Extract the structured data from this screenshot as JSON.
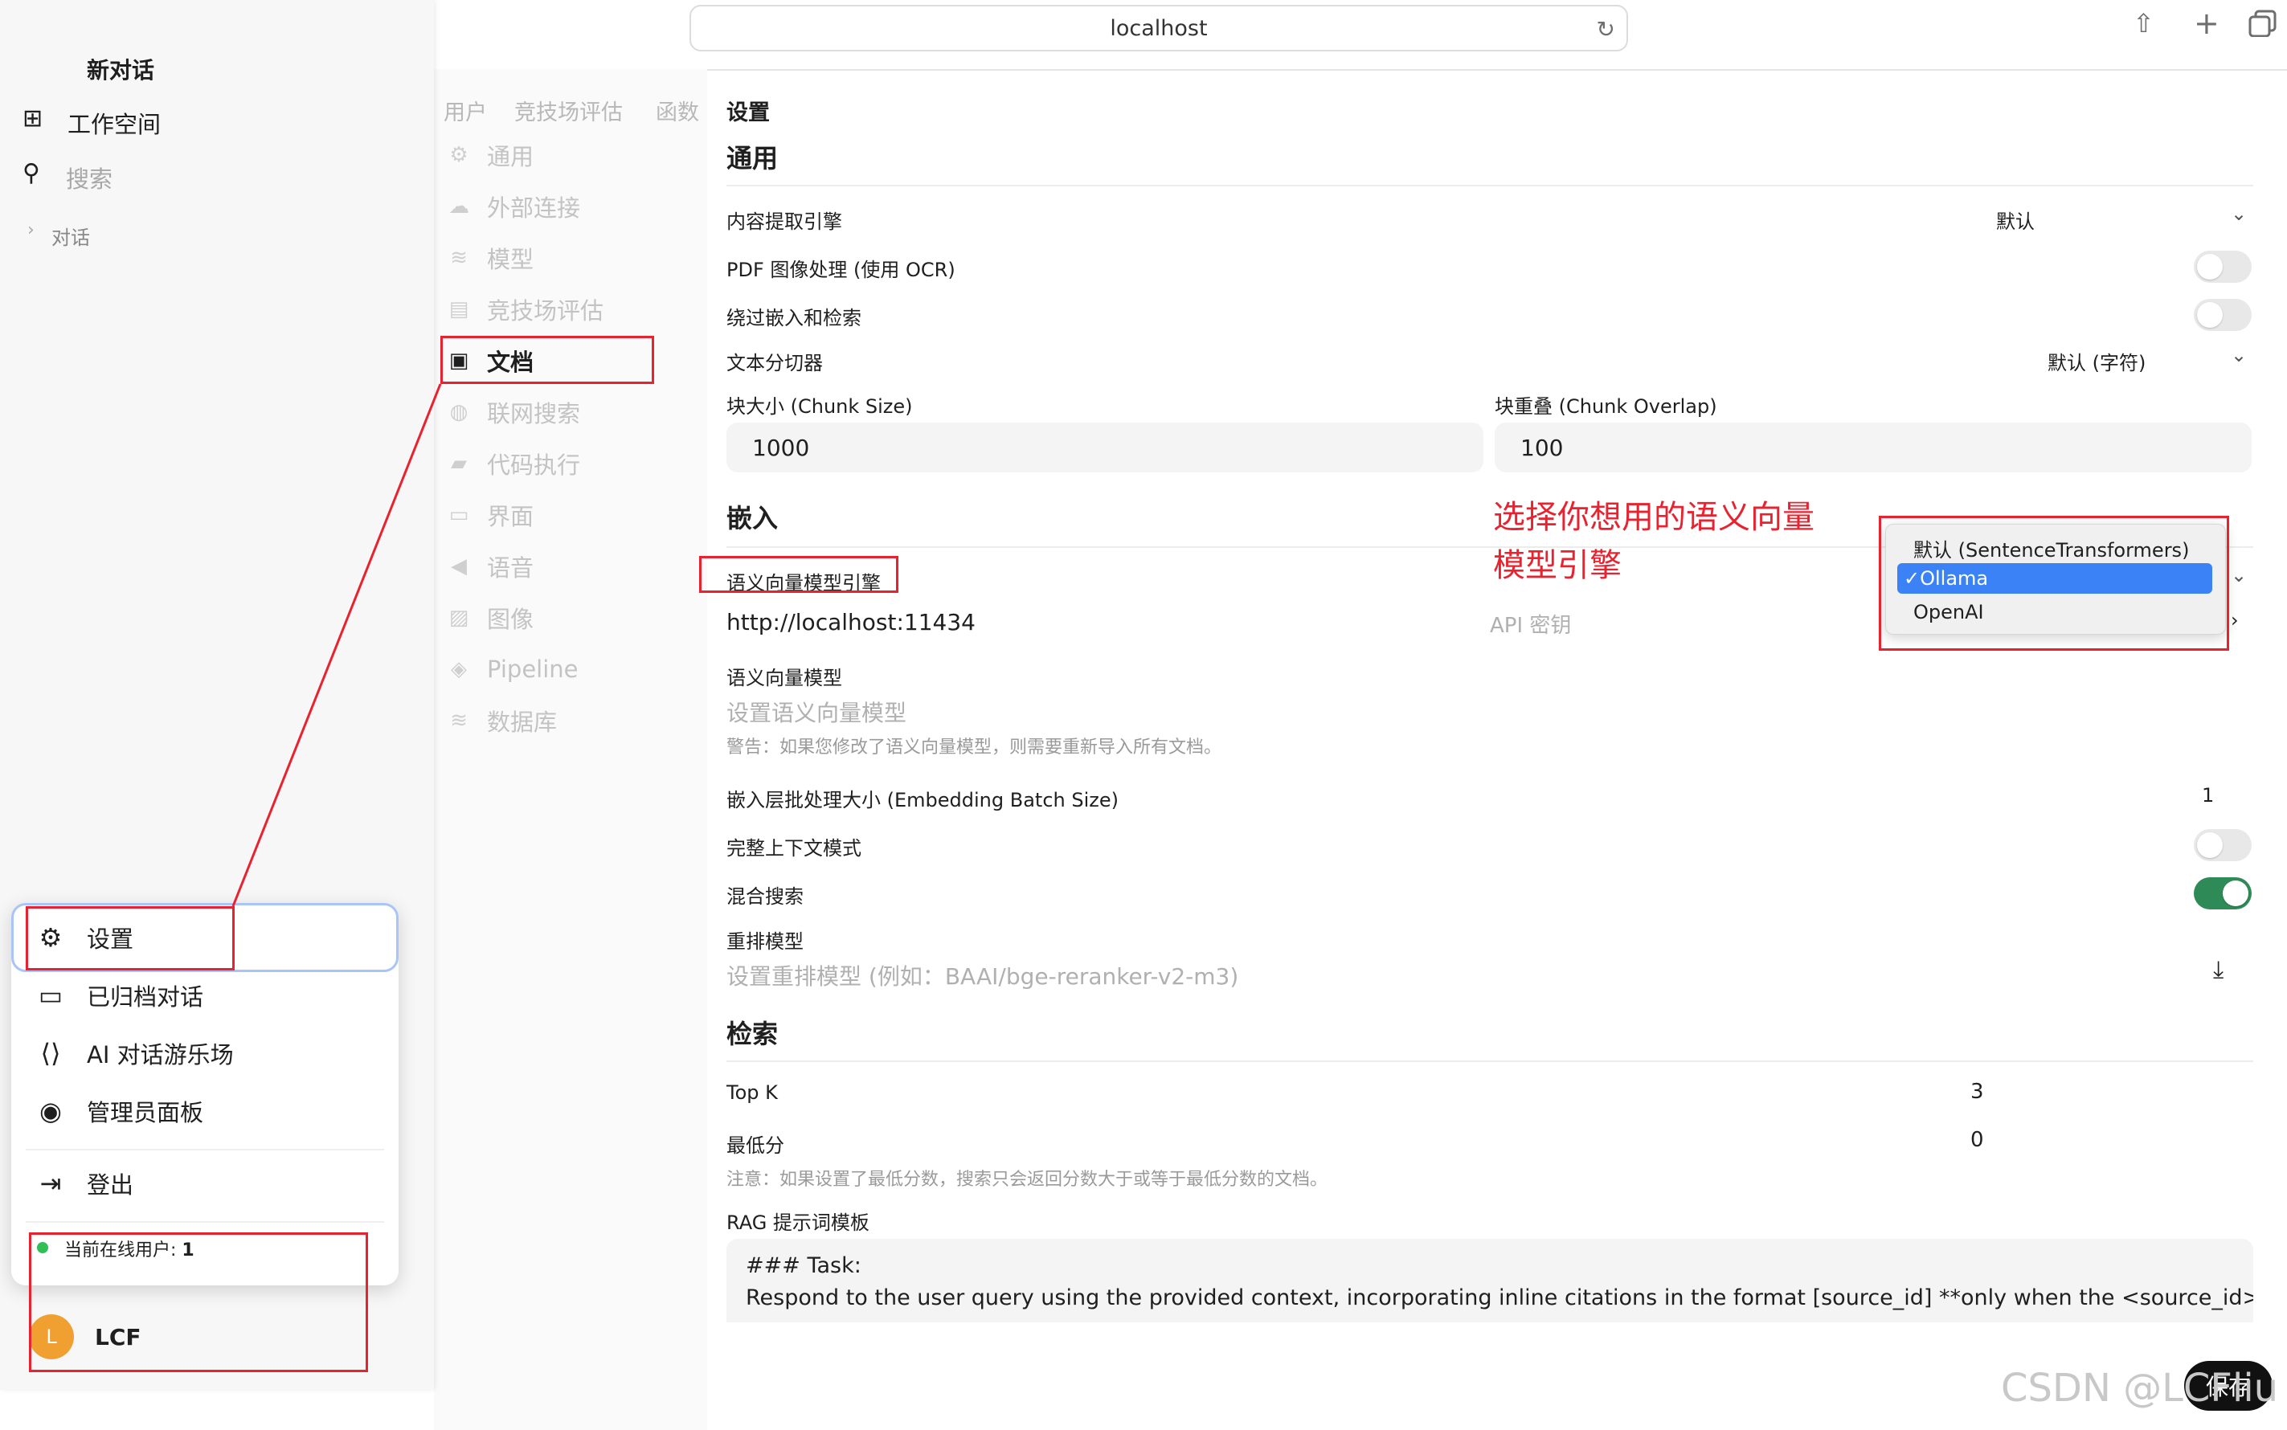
{
  "browser": {
    "url": "localhost"
  },
  "sidebar": {
    "new_chat": "新对话",
    "workspace": "工作空间",
    "search_placeholder": "搜索",
    "chats_label": "对话"
  },
  "settings_nav": {
    "top_tabs": [
      "用户",
      "竞技场评估",
      "函数",
      "设置"
    ],
    "items": [
      {
        "label": "通用",
        "icon": "gear-icon"
      },
      {
        "label": "外部连接",
        "icon": "cloud-icon"
      },
      {
        "label": "模型",
        "icon": "database-icon"
      },
      {
        "label": "竞技场评估",
        "icon": "document-icon"
      },
      {
        "label": "文档",
        "icon": "document-search-icon",
        "active": true
      },
      {
        "label": "联网搜索",
        "icon": "globe-icon"
      },
      {
        "label": "代码执行",
        "icon": "terminal-icon"
      },
      {
        "label": "界面",
        "icon": "monitor-icon"
      },
      {
        "label": "语音",
        "icon": "speaker-icon"
      },
      {
        "label": "图像",
        "icon": "image-icon"
      },
      {
        "label": "Pipeline",
        "icon": "layers-icon"
      },
      {
        "label": "数据库",
        "icon": "database-icon"
      }
    ]
  },
  "general": {
    "title": "通用",
    "content_engine_label": "内容提取引擎",
    "content_engine_value": "默认",
    "pdf_ocr_label": "PDF 图像处理 (使用 OCR)",
    "bypass_label": "绕过嵌入和检索",
    "splitter_label": "文本分切器",
    "splitter_value": "默认 (字符)",
    "chunk_size_label": "块大小 (Chunk Size)",
    "chunk_size_value": "1000",
    "chunk_overlap_label": "块重叠 (Chunk Overlap)",
    "chunk_overlap_value": "100"
  },
  "embedding": {
    "title": "嵌入",
    "engine_label": "语义向量模型引擎",
    "engine_options": [
      "默认 (SentenceTransformers)",
      "Ollama",
      "OpenAI"
    ],
    "engine_selected": "Ollama",
    "url_value": "http://localhost:11434",
    "api_key_placeholder": "API 密钥",
    "model_label": "语义向量模型",
    "model_placeholder": "设置语义向量模型",
    "model_warning": "警告：如果您修改了语义向量模型，则需要重新导入所有文档。",
    "batch_label": "嵌入层批处理大小 (Embedding Batch Size)",
    "batch_value": "1",
    "full_context_label": "完整上下文模式",
    "full_context_on": false,
    "hybrid_label": "混合搜索",
    "hybrid_on": true,
    "rerank_label": "重排模型",
    "rerank_placeholder": "设置重排模型 (例如：BAAI/bge-reranker-v2-m3)"
  },
  "retrieval": {
    "title": "检索",
    "topk_label": "Top K",
    "topk_value": "3",
    "min_score_label": "最低分",
    "min_score_value": "0",
    "min_score_note": "注意：如果设置了最低分数，搜索只会返回分数大于或等于最低分数的文档。",
    "rag_label": "RAG 提示词模板",
    "rag_line1": "### Task:",
    "rag_line2": "Respond to the user query using the provided context, incorporating inline citations in the format [source_id] **only when the <source_id> tag"
  },
  "annotation": {
    "text_line1": "选择你想用的语义向量",
    "text_line2": "模型引擎"
  },
  "user_menu": {
    "settings": "设置",
    "archived": "已归档对话",
    "playground": "AI 对话游乐场",
    "admin": "管理员面板",
    "logout": "登出",
    "online_users_label": "当前在线用户: ",
    "online_users_count": "1"
  },
  "user": {
    "initial": "L",
    "name": "LCF"
  },
  "save_button": "保存",
  "watermark": "CSDN @LCFliu",
  "colors": {
    "accent_red": "#e8222e",
    "toggle_on": "#2e8b57",
    "select_blue": "#3a82f6",
    "avatar": "#f0a030"
  }
}
